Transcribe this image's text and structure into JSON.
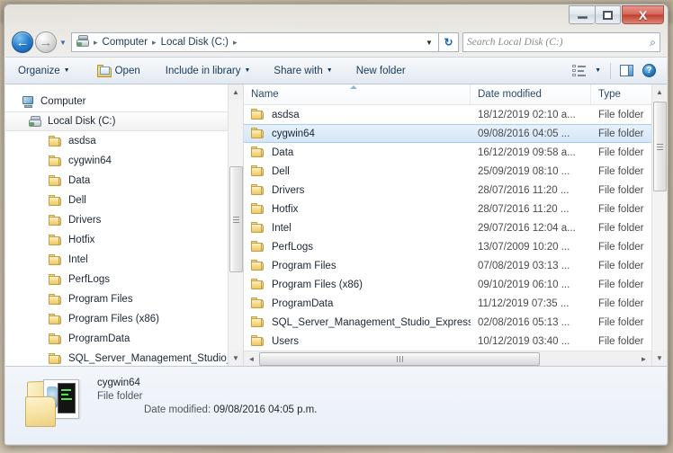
{
  "window": {
    "titlebar": {
      "minimize_label": "—",
      "maximize_label": "",
      "close_label": "X"
    }
  },
  "address_bar": {
    "back_glyph": "←",
    "forward_glyph": "→",
    "history_glyph": "▼",
    "crumbs": [
      "Computer",
      "Local Disk (C:)"
    ],
    "separator": "▸",
    "dropdown_glyph": "▼",
    "refresh_glyph": "↻",
    "search_placeholder": "Search Local Disk (C:)",
    "search_value": "",
    "search_icon_glyph": "⌕"
  },
  "toolbar": {
    "organize_label": "Organize",
    "open_label": "Open",
    "include_label": "Include in library",
    "share_label": "Share with",
    "new_folder_label": "New folder",
    "caret_glyph": "▼",
    "help_glyph": "?"
  },
  "nav_pane": {
    "items": [
      {
        "label": "Computer",
        "icon": "computer-icon",
        "level": 0,
        "selected": false
      },
      {
        "label": "Local Disk (C:)",
        "icon": "hard-disk-icon",
        "level": 1,
        "selected": true
      },
      {
        "label": "asdsa",
        "icon": "folder-icon",
        "level": 2,
        "selected": false
      },
      {
        "label": "cygwin64",
        "icon": "folder-icon",
        "level": 2,
        "selected": false
      },
      {
        "label": "Data",
        "icon": "folder-icon",
        "level": 2,
        "selected": false
      },
      {
        "label": "Dell",
        "icon": "folder-icon",
        "level": 2,
        "selected": false
      },
      {
        "label": "Drivers",
        "icon": "folder-icon",
        "level": 2,
        "selected": false
      },
      {
        "label": "Hotfix",
        "icon": "folder-icon",
        "level": 2,
        "selected": false
      },
      {
        "label": "Intel",
        "icon": "folder-icon",
        "level": 2,
        "selected": false
      },
      {
        "label": "PerfLogs",
        "icon": "folder-icon",
        "level": 2,
        "selected": false
      },
      {
        "label": "Program Files",
        "icon": "folder-icon",
        "level": 2,
        "selected": false
      },
      {
        "label": "Program Files (x86)",
        "icon": "folder-icon",
        "level": 2,
        "selected": false
      },
      {
        "label": "ProgramData",
        "icon": "folder-icon",
        "level": 2,
        "selected": false
      },
      {
        "label": "SQL_Server_Management_Studio_E",
        "icon": "folder-icon",
        "level": 2,
        "selected": false
      }
    ],
    "scroll_up_glyph": "▲",
    "scroll_down_glyph": "▼"
  },
  "file_list": {
    "columns": [
      "Name",
      "Date modified",
      "Type"
    ],
    "rows": [
      {
        "name": "asdsa",
        "date": "18/12/2019 02:10 a...",
        "type": "File folder",
        "selected": false
      },
      {
        "name": "cygwin64",
        "date": "09/08/2016 04:05 ...",
        "type": "File folder",
        "selected": true
      },
      {
        "name": "Data",
        "date": "16/12/2019 09:58 a...",
        "type": "File folder",
        "selected": false
      },
      {
        "name": "Dell",
        "date": "25/09/2019 08:10 ...",
        "type": "File folder",
        "selected": false
      },
      {
        "name": "Drivers",
        "date": "28/07/2016 11:20 ...",
        "type": "File folder",
        "selected": false
      },
      {
        "name": "Hotfix",
        "date": "28/07/2016 11:20 ...",
        "type": "File folder",
        "selected": false
      },
      {
        "name": "Intel",
        "date": "29/07/2016 12:04 a...",
        "type": "File folder",
        "selected": false
      },
      {
        "name": "PerfLogs",
        "date": "13/07/2009 10:20 ...",
        "type": "File folder",
        "selected": false
      },
      {
        "name": "Program Files",
        "date": "07/08/2019 03:13 ...",
        "type": "File folder",
        "selected": false
      },
      {
        "name": "Program Files (x86)",
        "date": "09/10/2019 06:10 ...",
        "type": "File folder",
        "selected": false
      },
      {
        "name": "ProgramData",
        "date": "11/12/2019 07:35 ...",
        "type": "File folder",
        "selected": false
      },
      {
        "name": "SQL_Server_Management_Studio_Express",
        "date": "02/08/2016 05:13 ...",
        "type": "File folder",
        "selected": false
      },
      {
        "name": "Users",
        "date": "10/12/2019 03:40 ...",
        "type": "File folder",
        "selected": false
      }
    ],
    "scroll_up_glyph": "▲",
    "scroll_down_glyph": "▼",
    "scroll_left_glyph": "◄",
    "scroll_right_glyph": "►"
  },
  "details_pane": {
    "name": "cygwin64",
    "type": "File folder",
    "date_label": "Date modified:",
    "date_value": "09/08/2016 04:05 p.m."
  },
  "colors": {
    "selection_blue": "#d4e7f9",
    "selection_border": "#aacdeb",
    "toolbar_text": "#15395b",
    "close_button_red": "#c0402f",
    "folder_yellow": "#f7dd92"
  }
}
